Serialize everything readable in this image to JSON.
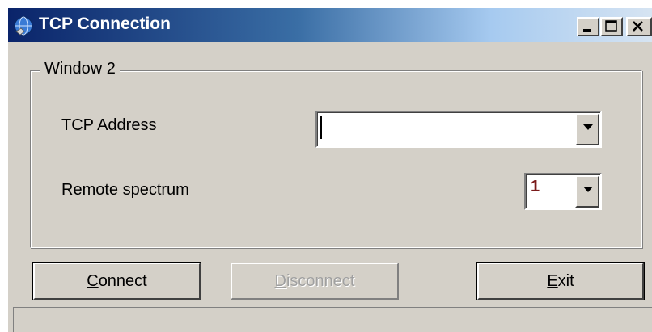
{
  "window": {
    "title": "TCP Connection",
    "icon": "globe-icon"
  },
  "title_buttons": {
    "minimize_icon": "minimize-icon",
    "maximize_icon": "maximize-icon",
    "close_icon": "close-icon"
  },
  "group": {
    "label": "Window 2"
  },
  "fields": {
    "tcp_address_label": "TCP Address",
    "tcp_address_value": "",
    "remote_spectrum_label": "Remote spectrum",
    "remote_spectrum_value": "1"
  },
  "buttons": {
    "connect": {
      "mnemonic": "C",
      "rest": "onnect"
    },
    "disconnect": {
      "mnemonic": "D",
      "rest": "isconnect",
      "enabled": false
    },
    "exit": {
      "mnemonic": "E",
      "rest": "xit"
    }
  },
  "colors": {
    "title_gradient_start": "#0a246a",
    "title_gradient_end": "#d6e4f2",
    "window_face": "#d4d0c8",
    "spectrum_value_color": "#7a1b1b"
  }
}
